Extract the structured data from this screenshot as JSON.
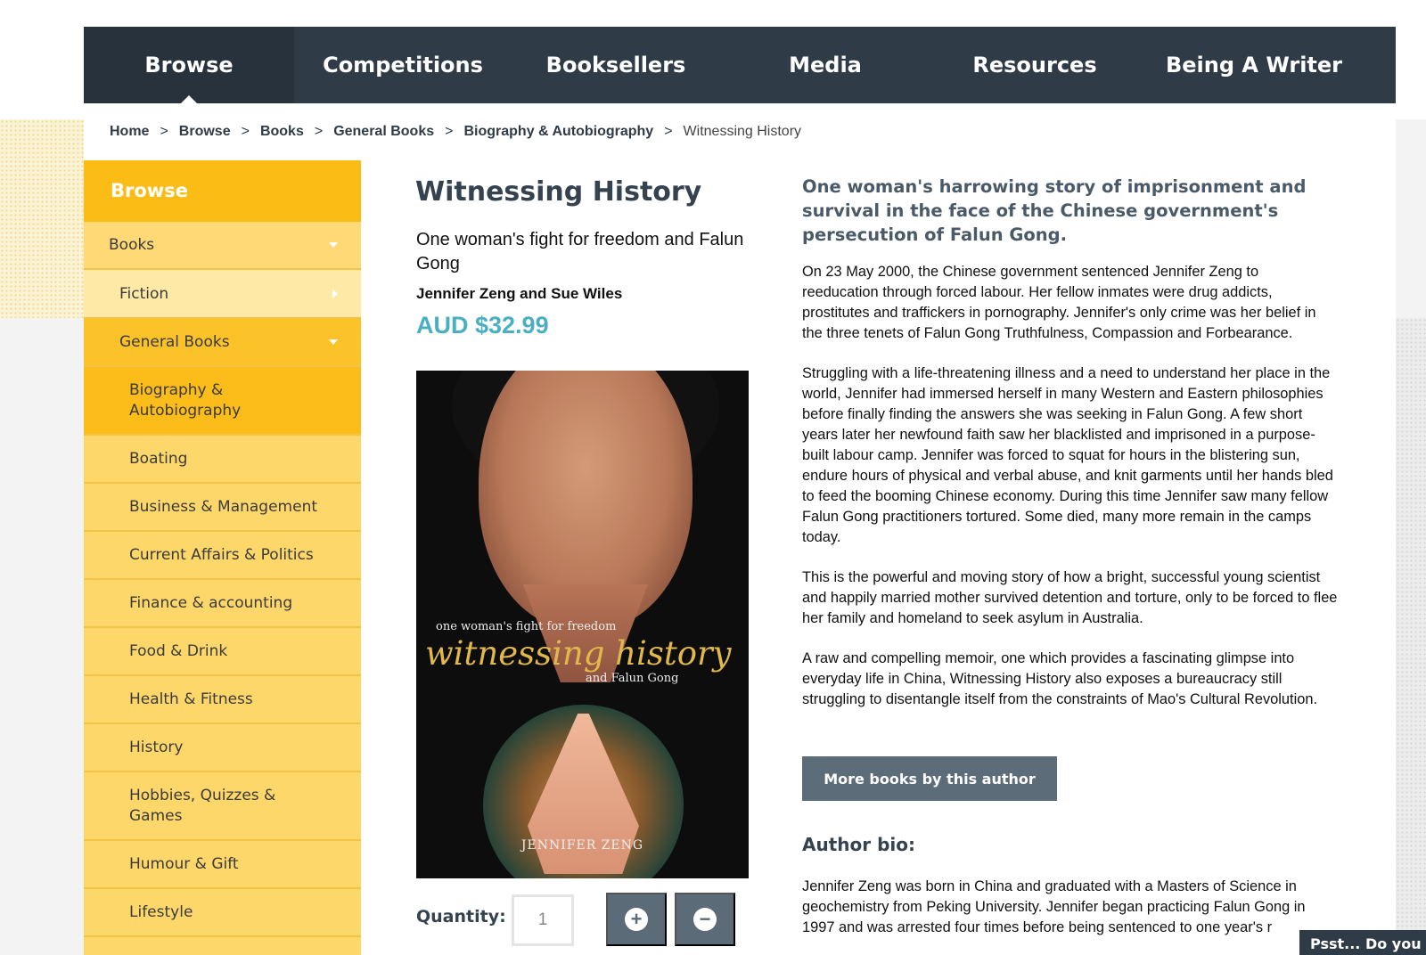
{
  "nav": {
    "items": [
      {
        "label": "Browse",
        "active": true
      },
      {
        "label": "Competitions"
      },
      {
        "label": "Booksellers"
      },
      {
        "label": "Media"
      },
      {
        "label": "Resources"
      },
      {
        "label": "Being A Writer"
      }
    ]
  },
  "breadcrumb": {
    "items": [
      "Home",
      "Browse",
      "Books",
      "General Books",
      "Biography & Autobiography"
    ],
    "separator": ">",
    "current": "Witnessing History"
  },
  "sidebar": {
    "header": "Browse",
    "books": "Books",
    "fiction": "Fiction",
    "general_books": "General Books",
    "biography": "Biography & Autobiography",
    "categories": [
      "Boating",
      "Business & Management",
      "Current Affairs & Politics",
      "Finance & accounting",
      "Food & Drink",
      "Health & Fitness",
      "History",
      "Hobbies, Quizzes & Games",
      "Humour & Gift",
      "Lifestyle"
    ]
  },
  "product": {
    "title": "Witnessing History",
    "subtitle": "One woman's fight for freedom and Falun Gong",
    "authors": "Jennifer Zeng and Sue Wiles",
    "price": "AUD $32.99",
    "cover": {
      "small_text": "one woman's fight for freedom",
      "big_text": "witnessing history",
      "and_text": "and Falun Gong",
      "author_text": "JENNIFER ZENG"
    },
    "quantity_label": "Quantity:",
    "quantity_value": "1",
    "plus_icon": "+",
    "minus_icon": "−"
  },
  "description": {
    "tagline": "One woman's harrowing story of imprisonment and survival in the face of the Chinese government's persecution of Falun Gong.",
    "paragraphs": [
      "On 23 May 2000, the Chinese government sentenced Jennifer Zeng to reeducation through forced labour. Her fellow inmates were drug addicts, prostitutes and traffickers in pornography. Jennifer's only crime was her belief in the three tenets of Falun Gong Truthfulness, Compassion and Forbearance.",
      "Struggling with a life-threatening illness and a need to understand her place in the world, Jennifer had immersed herself in many Western and Eastern philosophies before finally finding the answers she was seeking in Falun Gong. A few short years later her newfound faith saw her blacklisted and imprisoned in a purpose-built labour camp. Jennifer was forced to squat for hours in the blistering sun, endure hours of physical and verbal abuse, and knit garments until her hands bled to feed the booming Chinese economy. During this time Jennifer saw many fellow Falun Gong practitioners tortured. Some died, many more remain in the camps today.",
      "This is the powerful and moving story of how a bright, successful young scientist and happily married mother survived detention and torture, only to be forced to flee her family and homeland to seek asylum in Australia.",
      "A raw and compelling memoir, one which provides a fascinating glimpse into everyday life in China, Witnessing History also exposes a bureaucracy still struggling to disentangle itself from the constraints of Mao's Cultural Revolution."
    ],
    "more_button": "More books by this author",
    "bio_title": "Author bio:",
    "bio_text": "Jennifer Zeng was born in China and graduated with a Masters of Science in geochemistry from Peking University. Jennifer began practicing Falun Gong in 1997 and was arrested four times before being sentenced to one year's r"
  },
  "popup": {
    "label": "Psst... Do you lo"
  },
  "colors": {
    "nav_bg": "#2f3b46",
    "sidebar_header": "#fbbd15",
    "sidebar_bg": "#fdd76a",
    "price": "#4ab0c1",
    "button_bg": "#5d6c79"
  }
}
